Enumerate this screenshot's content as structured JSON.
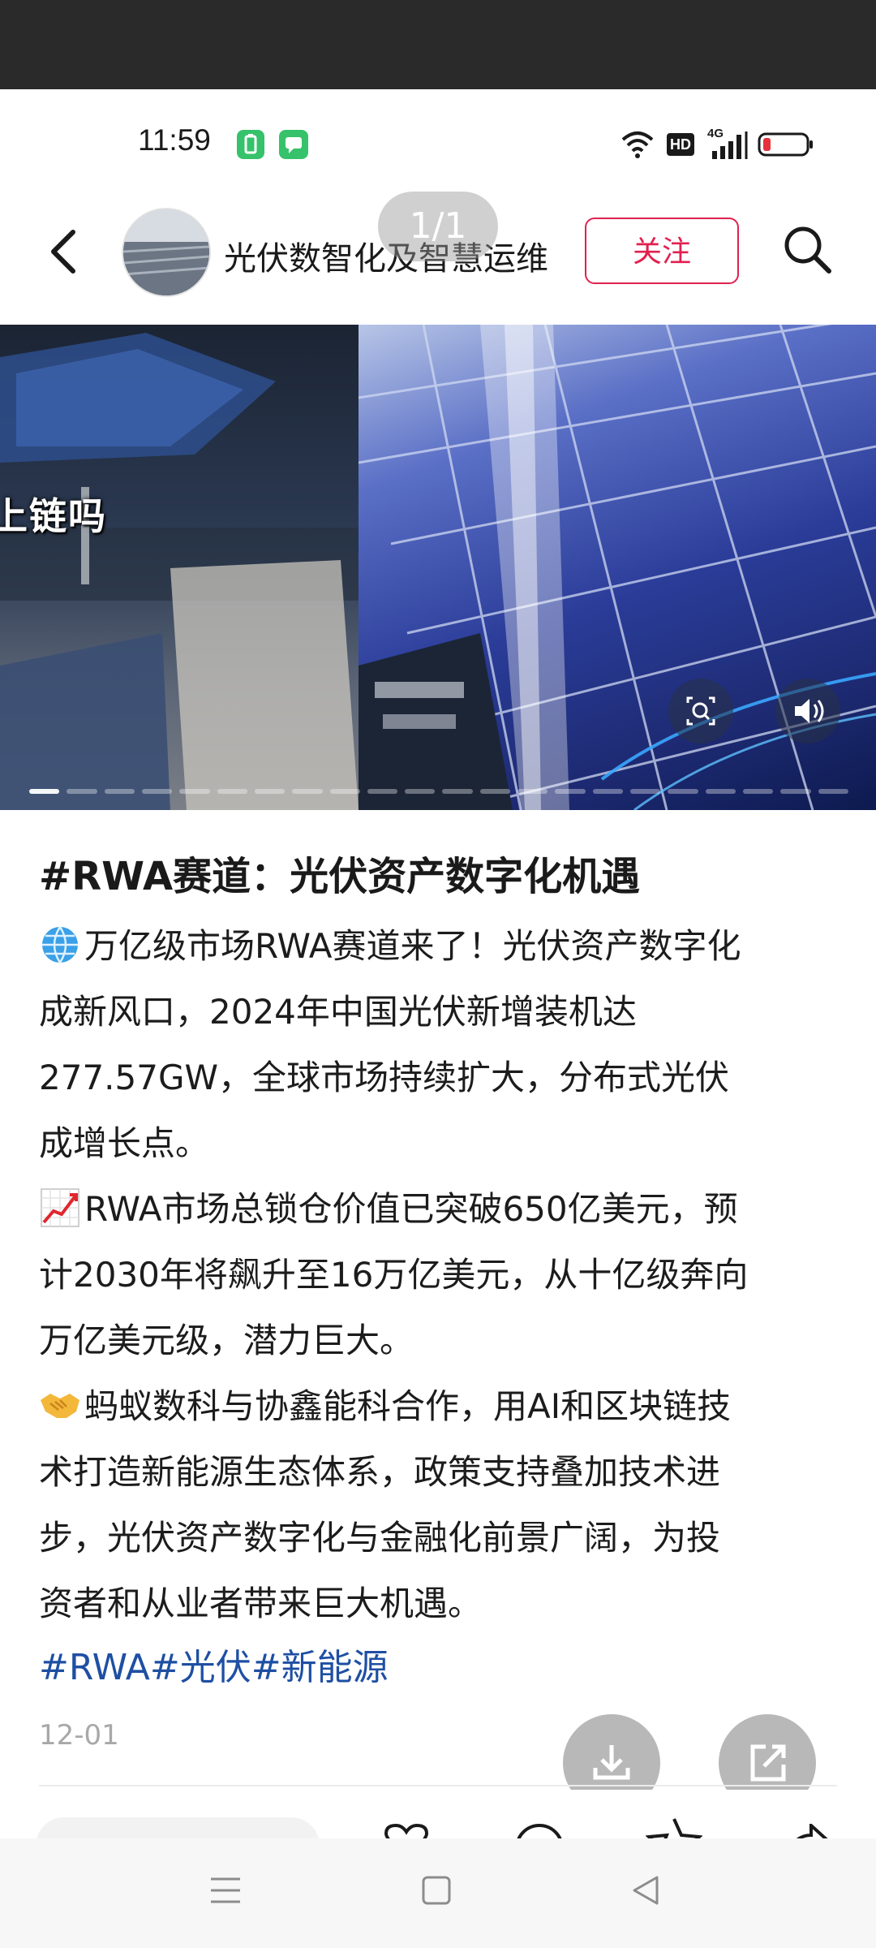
{
  "status_bar": {
    "time": "11:59",
    "network_label": "HD",
    "signal_label": "4G",
    "battery_color": "#e5313b"
  },
  "header": {
    "account_name": "光伏数智化及智慧运维",
    "page_indicator": "1/1",
    "follow_label": "关注"
  },
  "media": {
    "overlay_caption": "产上链吗",
    "carousel_total_segments": 22,
    "carousel_active_segment": 1
  },
  "post": {
    "title": "#RWA赛道：光伏资产数字化机遇",
    "paragraphs": [
      {
        "emoji": "globe-icon",
        "lines": [
          "万亿级市场RWA赛道来了！光伏资产数字化",
          "成新风口，2024年中国光伏新增装机达",
          "277.57GW，全球市场持续扩大，分布式光伏",
          "成增长点。"
        ]
      },
      {
        "emoji": "chart-up-icon",
        "lines": [
          "RWA市场总锁仓价值已突破650亿美元，预",
          "计2030年将飙升至16万亿美元，从十亿级奔向",
          "万亿美元级，潜力巨大。"
        ]
      },
      {
        "emoji": "handshake-icon",
        "lines": [
          "蚂蚁数科与协鑫能科合作，用AI和区块链技",
          "术打造新能源生态体系，政策支持叠加技术进",
          "步，光伏资产数字化与金融化前景广阔，为投",
          "资者和从业者带来巨大机遇。"
        ]
      }
    ],
    "tags": "#RWA#光伏#新能源",
    "date": "12-01"
  },
  "colors": {
    "accent_red": "#e0214f",
    "tag_blue": "#1e4fa3"
  }
}
